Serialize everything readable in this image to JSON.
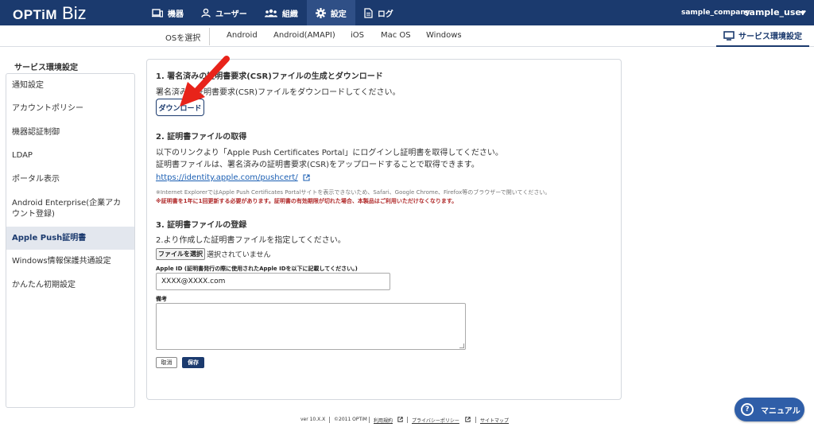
{
  "header": {
    "logo_main": "OPTiM",
    "logo_sub": "Biz",
    "nav": [
      {
        "label": "機器",
        "icon": "device-icon"
      },
      {
        "label": "ユーザー",
        "icon": "user-icon"
      },
      {
        "label": "組織",
        "icon": "group-icon"
      },
      {
        "label": "設定",
        "icon": "gear-icon"
      },
      {
        "label": "ログ",
        "icon": "log-icon"
      }
    ],
    "active_nav": "設定",
    "company": "sample_company",
    "user": "sample_user"
  },
  "os_bar": {
    "label": "OSを選択",
    "tabs": [
      "Android",
      "Android(AMAPI)",
      "iOS",
      "Mac OS",
      "Windows"
    ],
    "service_tab": "サービス環境設定"
  },
  "sidebar": {
    "title": "サービス環境設定",
    "items": [
      "通知設定",
      "アカウントポリシー",
      "機器認証制御",
      "LDAP",
      "ポータル表示",
      "Android Enterprise(企業アカウント登録)",
      "Apple Push証明書",
      "Windows情報保護共通設定",
      "かんたん初期設定"
    ],
    "active_item": "Apple Push証明書"
  },
  "main": {
    "section1": {
      "title": "1. 署名済みの証明書要求(CSR)ファイルの生成とダウンロード",
      "desc": "署名済みの証明書要求(CSR)ファイルをダウンロードしてください。",
      "download_label": "ダウンロード"
    },
    "section2": {
      "title": "2. 証明書ファイルの取得",
      "desc1": "以下のリンクより「Apple Push Certificates Portal」にログインし証明書を取得してください。",
      "desc2": "証明書ファイルは、署名済みの証明書要求(CSR)をアップロードすることで取得できます。",
      "link": "https://identity.apple.com/pushcert/",
      "note1": "※Internet ExplorerではApple Push Certificates Portalサイトを表示できないため、Safari、Google Chrome、Firefox等のブラウザーで開いてください。",
      "note2": "※証明書を1年に1回更新する必要があります。証明書の有効期限が切れた場合、本製品はご利用いただけなくなります。"
    },
    "section3": {
      "title": "3. 証明書ファイルの登録",
      "desc": "2.より作成した証明書ファイルを指定してください。",
      "file_button": "ファイルを選択",
      "file_status": "選択されていません",
      "apple_id_label": "Apple ID (証明書発行の際に使用されたApple IDを以下に記載してください。)",
      "apple_id_value": "XXXX@XXXX.com",
      "memo_label": "備考",
      "cancel_label": "取消",
      "save_label": "保存"
    }
  },
  "footer": {
    "version": "ver 10.X.X",
    "copyright": "©2011 OPTiM",
    "terms": "利用規約",
    "privacy": "プライバシーポリシー",
    "sitemap": "サイトマップ"
  },
  "manual_label": "マニュアル",
  "colors": {
    "header_bg": "#1b3a6e",
    "accent": "#1b3a6e",
    "link": "#1b5fb3",
    "warning": "#b02a2a",
    "annotation_arrow": "#e8231a"
  }
}
